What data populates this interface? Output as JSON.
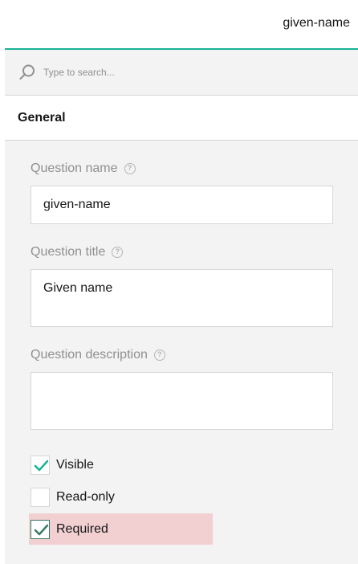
{
  "header": {
    "title": "given-name"
  },
  "search": {
    "placeholder": "Type to search..."
  },
  "section": {
    "title": "General"
  },
  "fields": {
    "question_name": {
      "label": "Question name",
      "value": "given-name"
    },
    "question_title": {
      "label": "Question title",
      "value": "Given name"
    },
    "question_description": {
      "label": "Question description",
      "value": ""
    }
  },
  "checkboxes": [
    {
      "label": "Visible",
      "checked": true
    },
    {
      "label": "Read-only",
      "checked": false
    },
    {
      "label": "Required",
      "checked": true
    }
  ],
  "help_glyph": "?",
  "colors": {
    "accent": "#19b394",
    "highlight": "#f2d0d2",
    "required_check": "#3a7a66"
  }
}
